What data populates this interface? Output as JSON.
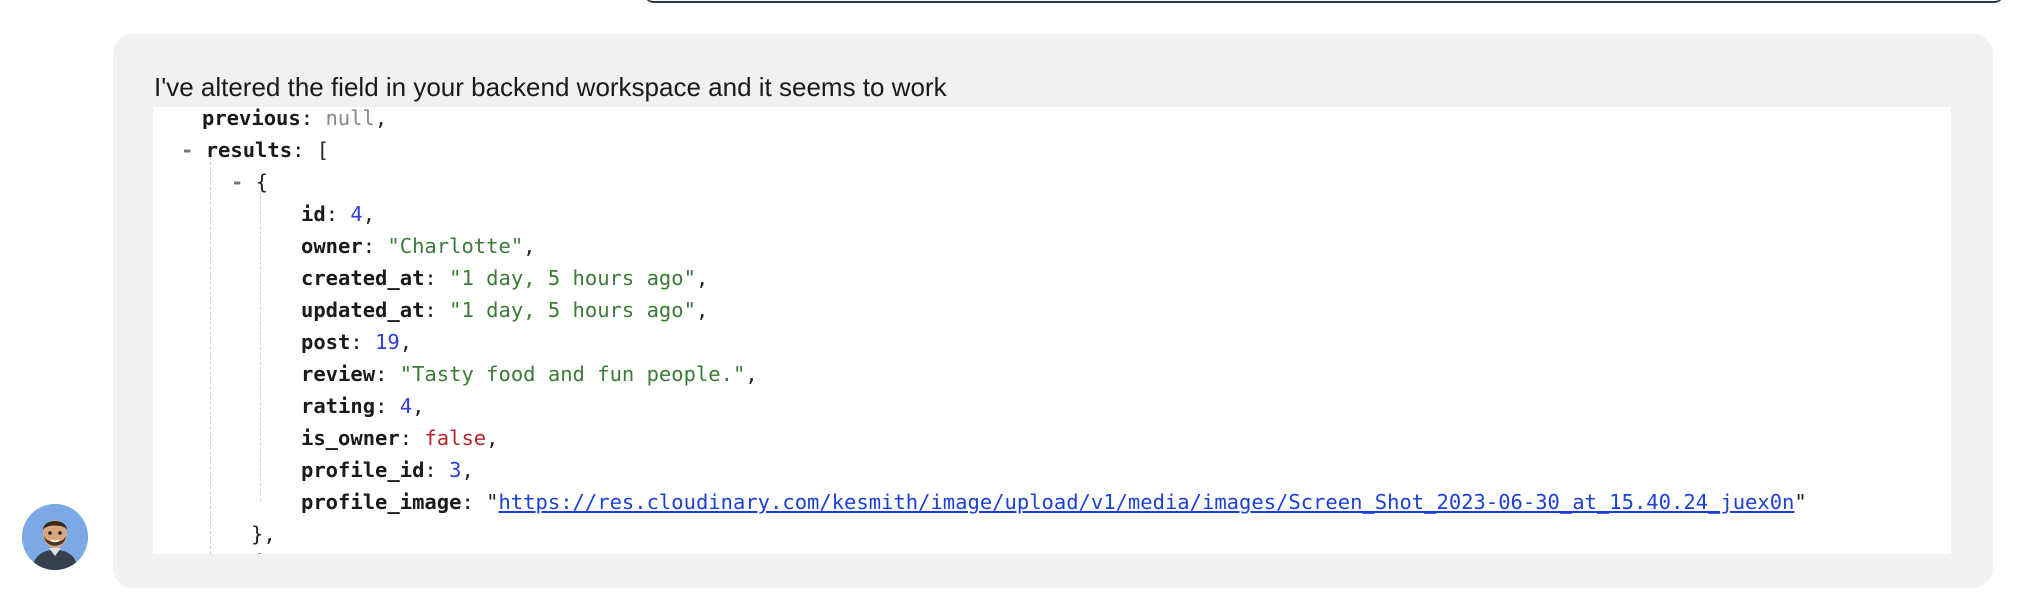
{
  "chat": {
    "message": "I've altered the field in your backend workspace and it seems to work"
  },
  "json_view": {
    "previous_key": "previous",
    "previous_value": "null",
    "results_collapse": "-",
    "results_key": "results",
    "results_open": "[",
    "item_collapse": "-",
    "item_open": "{",
    "fields": {
      "id": {
        "key": "id",
        "value": "4"
      },
      "owner": {
        "key": "owner",
        "value": "\"Charlotte\""
      },
      "created_at": {
        "key": "created_at",
        "value": "\"1 day, 5 hours ago\""
      },
      "updated_at": {
        "key": "updated_at",
        "value": "\"1 day, 5 hours ago\""
      },
      "post": {
        "key": "post",
        "value": "19"
      },
      "review": {
        "key": "review",
        "value": "\"Tasty food and fun people.\""
      },
      "rating": {
        "key": "rating",
        "value": "4"
      },
      "is_owner": {
        "key": "is_owner",
        "value": "false"
      },
      "profile_id": {
        "key": "profile_id",
        "value": "3"
      },
      "profile_image": {
        "key": "profile_image",
        "value": "https://res.cloudinary.com/kesmith/image/upload/v1/media/images/Screen_Shot_2023-06-30_at_15.40.24_juex0n"
      }
    },
    "item_close": "},",
    "next_item_open": "{"
  },
  "colors": {
    "bubble_background": "#f1f1f1",
    "string": "#3c7a38",
    "number": "#2d3fd6",
    "boolean": "#b3262b",
    "null": "#888888",
    "link": "#1c3fd6"
  },
  "icons": {
    "avatar": "user-avatar-icon"
  }
}
